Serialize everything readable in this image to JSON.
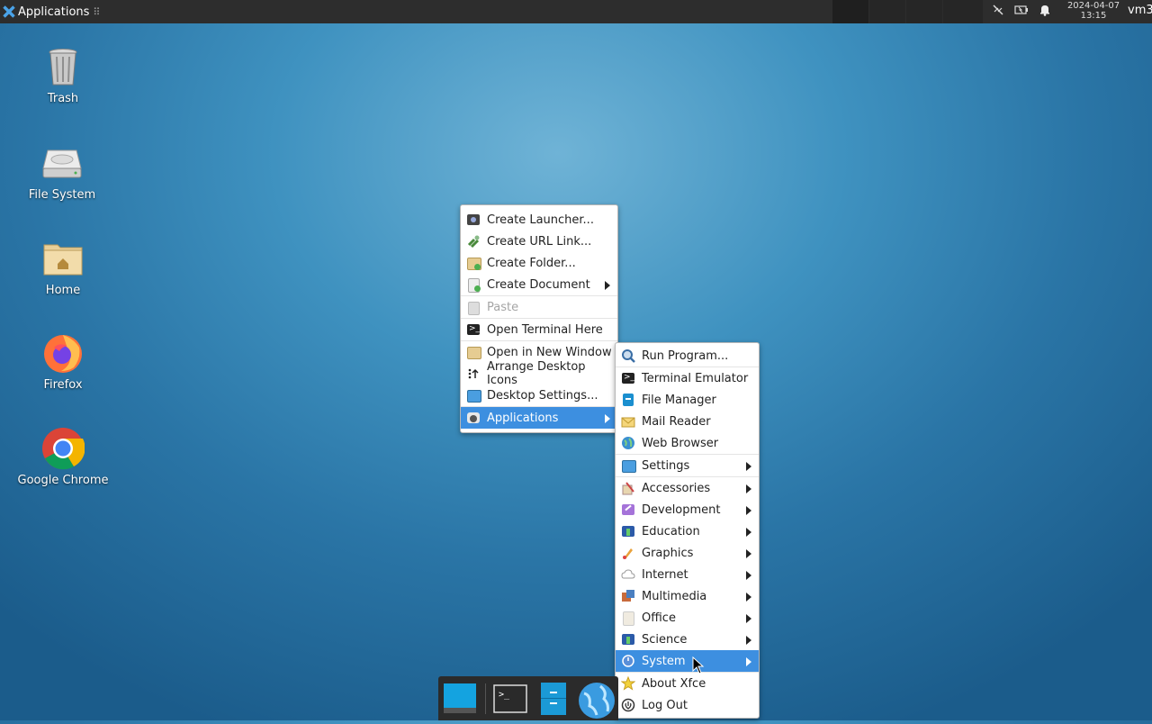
{
  "top_panel": {
    "applications_label": "Applications",
    "handle_glyph": "⠿",
    "clock_date": "2024-04-07",
    "clock_time": "13:15",
    "user": "vm3",
    "tray_icons": [
      "network-disconnected-icon",
      "battery-icon",
      "notification-bell-icon"
    ]
  },
  "desktop_icons": [
    {
      "label": "Trash",
      "icon": "trash-icon"
    },
    {
      "label": "File System",
      "icon": "drive-icon"
    },
    {
      "label": "Home",
      "icon": "home-folder-icon"
    },
    {
      "label": "Firefox",
      "icon": "firefox-icon"
    },
    {
      "label": "Google Chrome",
      "icon": "chrome-icon"
    }
  ],
  "context_menu": {
    "items": [
      {
        "label": "Create Launcher...",
        "icon": "launcher-icon"
      },
      {
        "label": "Create URL Link...",
        "icon": "link-icon"
      },
      {
        "label": "Create Folder...",
        "icon": "folder-new-icon"
      },
      {
        "label": "Create Document",
        "icon": "document-new-icon",
        "submenu": true
      },
      {
        "label": "Paste",
        "icon": "paste-icon",
        "disabled": true
      },
      {
        "label": "Open Terminal Here",
        "icon": "terminal-icon"
      },
      {
        "label": "Open in New Window",
        "icon": "folder-icon"
      },
      {
        "label": "Arrange Desktop Icons",
        "icon": "arrange-icon"
      },
      {
        "label": "Desktop Settings...",
        "icon": "desktop-settings-icon"
      },
      {
        "label": "Applications",
        "icon": "applications-icon",
        "submenu": true,
        "active": true
      }
    ]
  },
  "apps_submenu": {
    "items": [
      {
        "label": "Run Program...",
        "icon": "run-icon"
      },
      {
        "label": "Terminal Emulator",
        "icon": "terminal-icon"
      },
      {
        "label": "File Manager",
        "icon": "file-manager-icon"
      },
      {
        "label": "Mail Reader",
        "icon": "mail-icon"
      },
      {
        "label": "Web Browser",
        "icon": "web-browser-icon"
      },
      {
        "label": "Settings",
        "icon": "settings-icon",
        "submenu": true
      },
      {
        "label": "Accessories",
        "icon": "accessories-icon",
        "submenu": true
      },
      {
        "label": "Development",
        "icon": "development-icon",
        "submenu": true
      },
      {
        "label": "Education",
        "icon": "education-icon",
        "submenu": true
      },
      {
        "label": "Graphics",
        "icon": "graphics-icon",
        "submenu": true
      },
      {
        "label": "Internet",
        "icon": "internet-icon",
        "submenu": true
      },
      {
        "label": "Multimedia",
        "icon": "multimedia-icon",
        "submenu": true
      },
      {
        "label": "Office",
        "icon": "office-icon",
        "submenu": true
      },
      {
        "label": "Science",
        "icon": "science-icon",
        "submenu": true
      },
      {
        "label": "System",
        "icon": "system-icon",
        "submenu": true,
        "active": true
      },
      {
        "label": "About Xfce",
        "icon": "about-star-icon"
      },
      {
        "label": "Log Out",
        "icon": "logout-icon"
      }
    ]
  },
  "dock": {
    "items": [
      "show-desktop-icon",
      "terminal-icon",
      "file-manager-icon",
      "web-browser-icon"
    ]
  },
  "colors": {
    "panel": "#2d2d2d",
    "menu_highlight": "#3d8fe0",
    "desktop_blue": "#2a75a6"
  }
}
